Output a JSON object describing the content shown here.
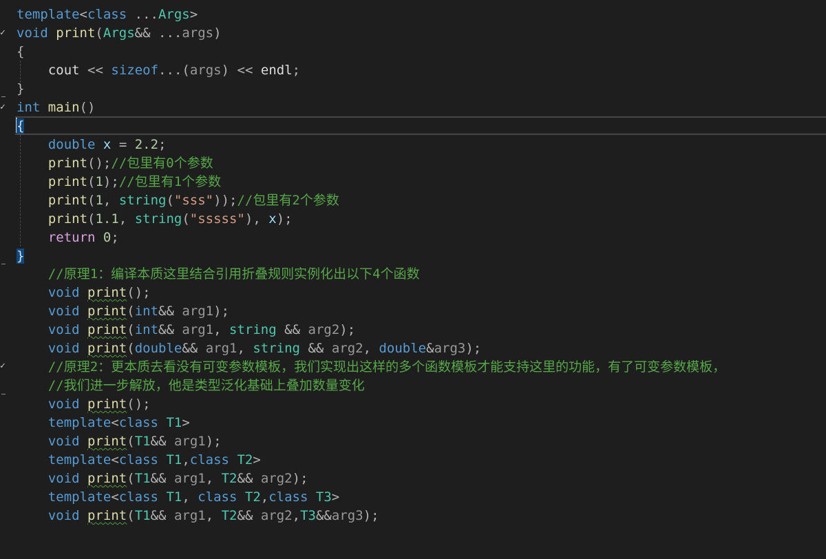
{
  "editor": {
    "lines": [
      "template<class ...Args>",
      "void print(Args&& ...args)",
      "{",
      "    cout << sizeof...(args) << endl;",
      "}",
      "int main()",
      "{",
      "    double x = 2.2;",
      "    print();//包里有0个参数",
      "    print(1);//包里有1个参数",
      "    print(1, string(\"sss\"));//包里有2个参数",
      "    print(1.1, string(\"sssss\"), x);",
      "    return 0;",
      "}",
      "    //原理1：编译本质这里结合引用折叠规则实例化出以下4个函数",
      "    void print();",
      "    void print(int&& arg1);",
      "    void print(int&& arg1, string && arg2);",
      "    void print(double&& arg1, string && arg2, double&arg3);",
      "    //原理2：更本质去看没有可变参数模板，我们实现出这样的多个函数模板才能支持这里的功能，有了可变参数模板，",
      "    //我们进一步解放，他是类型泛化基础上叠加数量变化",
      "    void print();",
      "    template<class T1>",
      "    void print(T1&& arg1);",
      "    template<class T1,class T2>",
      "    void print(T1&& arg1, T2&& arg2);",
      "    template<class T1, class T2,class T3>",
      "    void print(T1&& arg1, T2&& arg2,T3&&arg3);"
    ],
    "fold_marker": "✓"
  },
  "colors": {
    "background": "#1e1e1e",
    "keyword": "#569cd6",
    "control_keyword": "#d8a0df",
    "type": "#4ec9b0",
    "function": "#dcdcaa",
    "comment": "#57a64a",
    "string": "#d69d85",
    "number": "#b5cea8",
    "variable": "#9cdcfe"
  }
}
